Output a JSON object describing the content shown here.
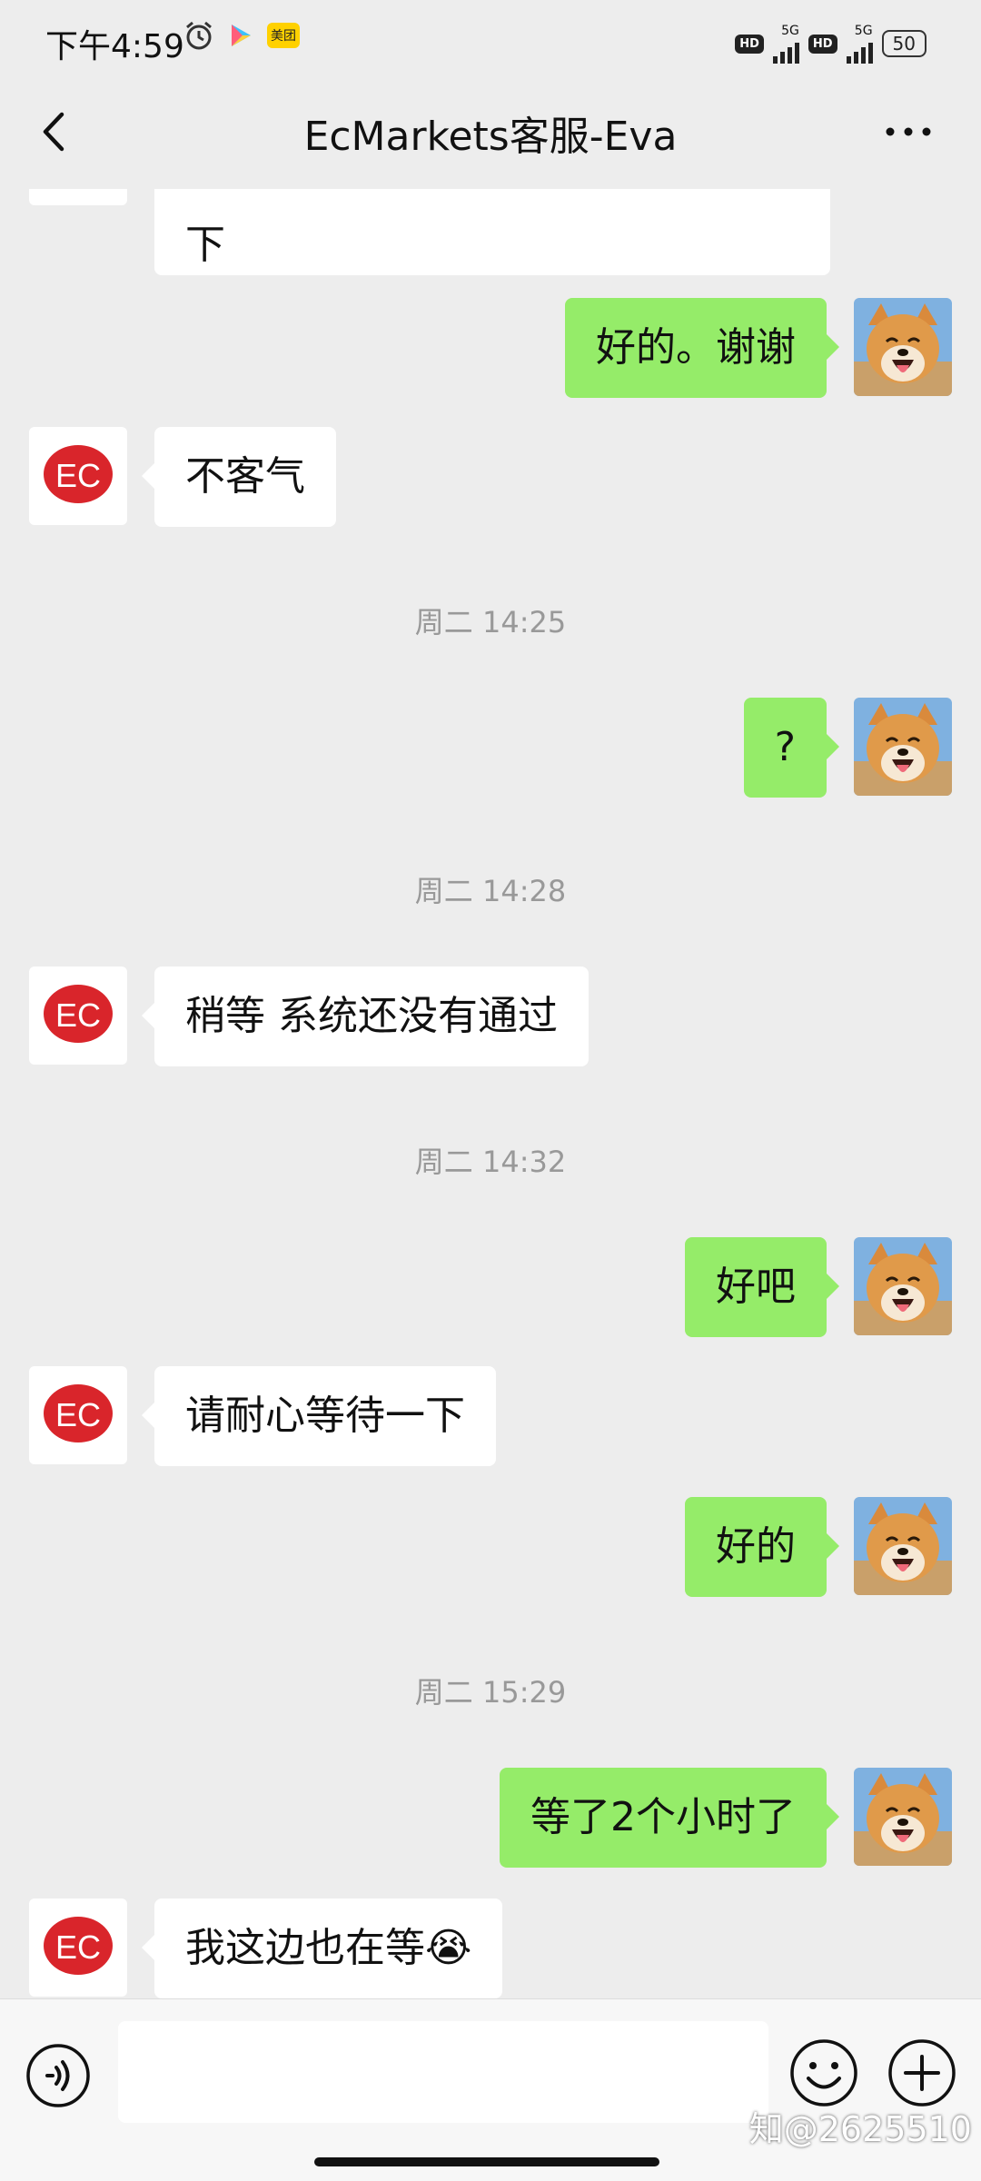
{
  "status_bar": {
    "time": "下午4:59",
    "app_badge": "美团",
    "hd1": "HD",
    "net1": "5G",
    "hd2": "HD",
    "net2": "5G",
    "battery": "50"
  },
  "header": {
    "title": "EcMarkets客服-Eva"
  },
  "avatars": {
    "agent_logo_text": "EC"
  },
  "messages": [
    {
      "type": "left",
      "text": "下"
    },
    {
      "type": "right",
      "text": "好的。谢谢"
    },
    {
      "type": "left",
      "text": "不客气"
    },
    {
      "type": "time",
      "text": "周二 14:25"
    },
    {
      "type": "right",
      "text": "?"
    },
    {
      "type": "time",
      "text": "周二 14:28"
    },
    {
      "type": "left",
      "text": "稍等 系统还没有通过"
    },
    {
      "type": "time",
      "text": "周二 14:32"
    },
    {
      "type": "right",
      "text": "好吧"
    },
    {
      "type": "left",
      "text": "请耐心等待一下"
    },
    {
      "type": "right",
      "text": "好的"
    },
    {
      "type": "time",
      "text": "周二 15:29"
    },
    {
      "type": "right",
      "text": "等了2个小时了"
    },
    {
      "type": "left",
      "text": "我这边也在等😭"
    }
  ],
  "input_bar": {
    "watermark": "知@2625510"
  },
  "colors": {
    "accent_green": "#95ec69",
    "background": "#ededed",
    "ec_red": "#d9252b"
  }
}
